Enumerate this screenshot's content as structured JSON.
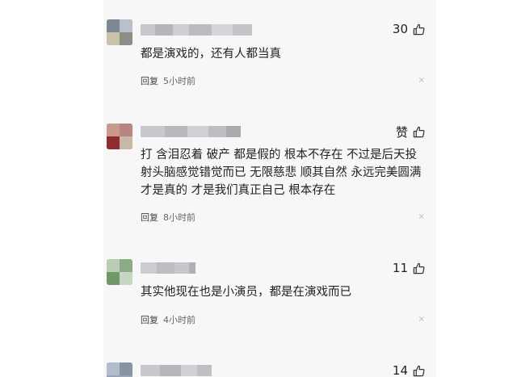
{
  "comments": [
    {
      "likes": "30",
      "text": "都是演戏的，还有人都当真",
      "reply_label": "回复",
      "time": "5小时前",
      "close": "×"
    },
    {
      "likes": "赞",
      "text": "打 含泪忍着 破产 都是假的 根本不存在 不过是后天投射头脑感觉错觉而已 无限慈悲 顺其自然 永远完美圆满 才是真的 才是我们真正自己 根本存在",
      "reply_label": "回复",
      "time": "8小时前",
      "close": "×"
    },
    {
      "likes": "11",
      "text": "其实他现在也是小演员，都是在演戏而已",
      "reply_label": "回复",
      "time": "4小时前",
      "close": "×"
    },
    {
      "likes": "14"
    }
  ],
  "icons": {
    "like": "thumbs-up-icon",
    "close": "close-icon"
  }
}
